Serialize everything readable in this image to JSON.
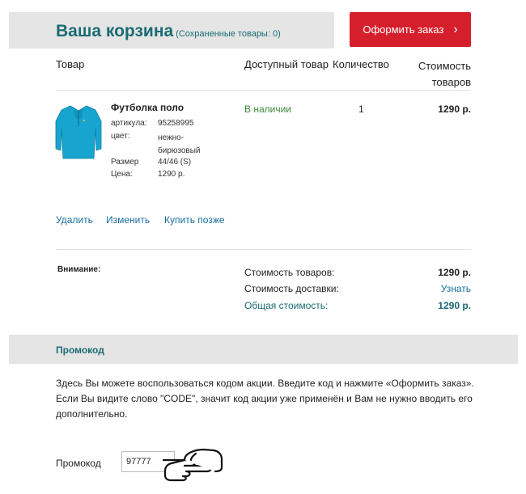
{
  "header": {
    "title": "Ваша корзина",
    "saved_items": "(Сохраненные товары: 0)",
    "checkout_label": "Оформить заказ"
  },
  "table": {
    "columns": [
      "Товар",
      "Доступный товар",
      "Количество",
      "Стоимость",
      "товаров"
    ]
  },
  "item": {
    "image_icon": "polo-shirt-icon",
    "name": "Футболка поло",
    "specs": [
      {
        "key": "артикула:",
        "value": "95258995"
      },
      {
        "key": "цвет:",
        "value_lines": [
          "нежно-",
          "бирюзовый"
        ]
      },
      {
        "key": "Размер",
        "value": "44/46 (S)"
      },
      {
        "key": "Цена:",
        "value": "1290 р."
      }
    ],
    "availability": "В наличии",
    "quantity": "1",
    "total": "1290 р.",
    "actions": {
      "delete": "Удалить",
      "edit": "Изменить",
      "buy_later": "Купить позже"
    }
  },
  "summary": {
    "attention_label": "Внимание:",
    "goods_cost_label": "Стоимость товаров:",
    "goods_cost_value": "1290 р.",
    "delivery_label": "Стоимость доставки:",
    "delivery_value": "Узнать",
    "total_label": "Общая стоимость:",
    "total_value": "1290 р."
  },
  "promo": {
    "title": "Промокод",
    "instructions": [
      "Здесь Вы можете воспользоваться кодом акции. Введите код и нажмите «Оформить заказ».",
      "Если Вы видите слово \"CODE\", значит код акции уже применён и Вам не нужно вводить его дополнительно."
    ],
    "field_label": "Промокод",
    "field_value": "97777",
    "pointer_icon": "pointing-hand-icon"
  },
  "colors": {
    "brand_teal": "#1b6b73",
    "checkout_red": "#d61f2c",
    "link_blue": "#1a6fa0",
    "in_stock_green": "#3a8a3a",
    "band_gray": "#e5e5e5"
  }
}
